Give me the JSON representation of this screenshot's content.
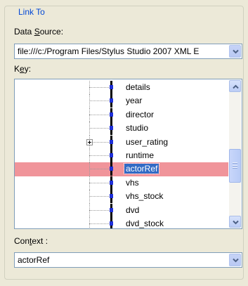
{
  "group": {
    "title": "Link To"
  },
  "data_source": {
    "label_pre": "Data ",
    "label_u": "S",
    "label_post": "ource:",
    "value": "file:///c:/Program Files/Stylus Studio 2007 XML E",
    "dropdown_icon": "chevron-down-icon"
  },
  "key": {
    "label_pre": "K",
    "label_u": "e",
    "label_post": "y:",
    "items": [
      {
        "label": "details"
      },
      {
        "label": "year"
      },
      {
        "label": "director"
      },
      {
        "label": "studio"
      },
      {
        "label": "user_rating",
        "expandable": true
      },
      {
        "label": "runtime"
      },
      {
        "label": "actorRef",
        "selected": true
      },
      {
        "label": "vhs"
      },
      {
        "label": "vhs_stock"
      },
      {
        "label": "dvd"
      },
      {
        "label": "dvd_stock"
      }
    ],
    "scroll_position": 0.62
  },
  "context": {
    "label_pre": "Con",
    "label_u": "t",
    "label_post": "ext :",
    "value": "actorRef",
    "dropdown_icon": "chevron-down-icon"
  },
  "colors": {
    "group_title": "#0046d5",
    "selection_row": "#f0949a",
    "selection_label": "#316ac5",
    "node_icon": "#1e2fd8"
  }
}
